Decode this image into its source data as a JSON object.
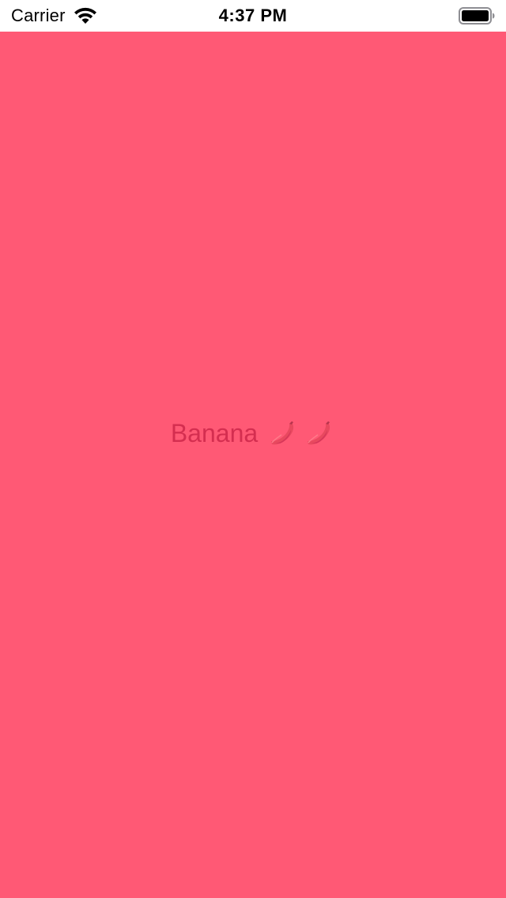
{
  "status_bar": {
    "carrier": "Carrier",
    "time": "4:37 PM",
    "wifi_icon": "wifi-icon",
    "battery_icon": "battery-icon"
  },
  "main": {
    "label_text": "Banana",
    "emoji_icons": [
      "banana-icon",
      "banana-icon"
    ]
  },
  "colors": {
    "background": "#ff5975",
    "label": "#d42e50",
    "status_bar_bg": "#ffffff"
  }
}
